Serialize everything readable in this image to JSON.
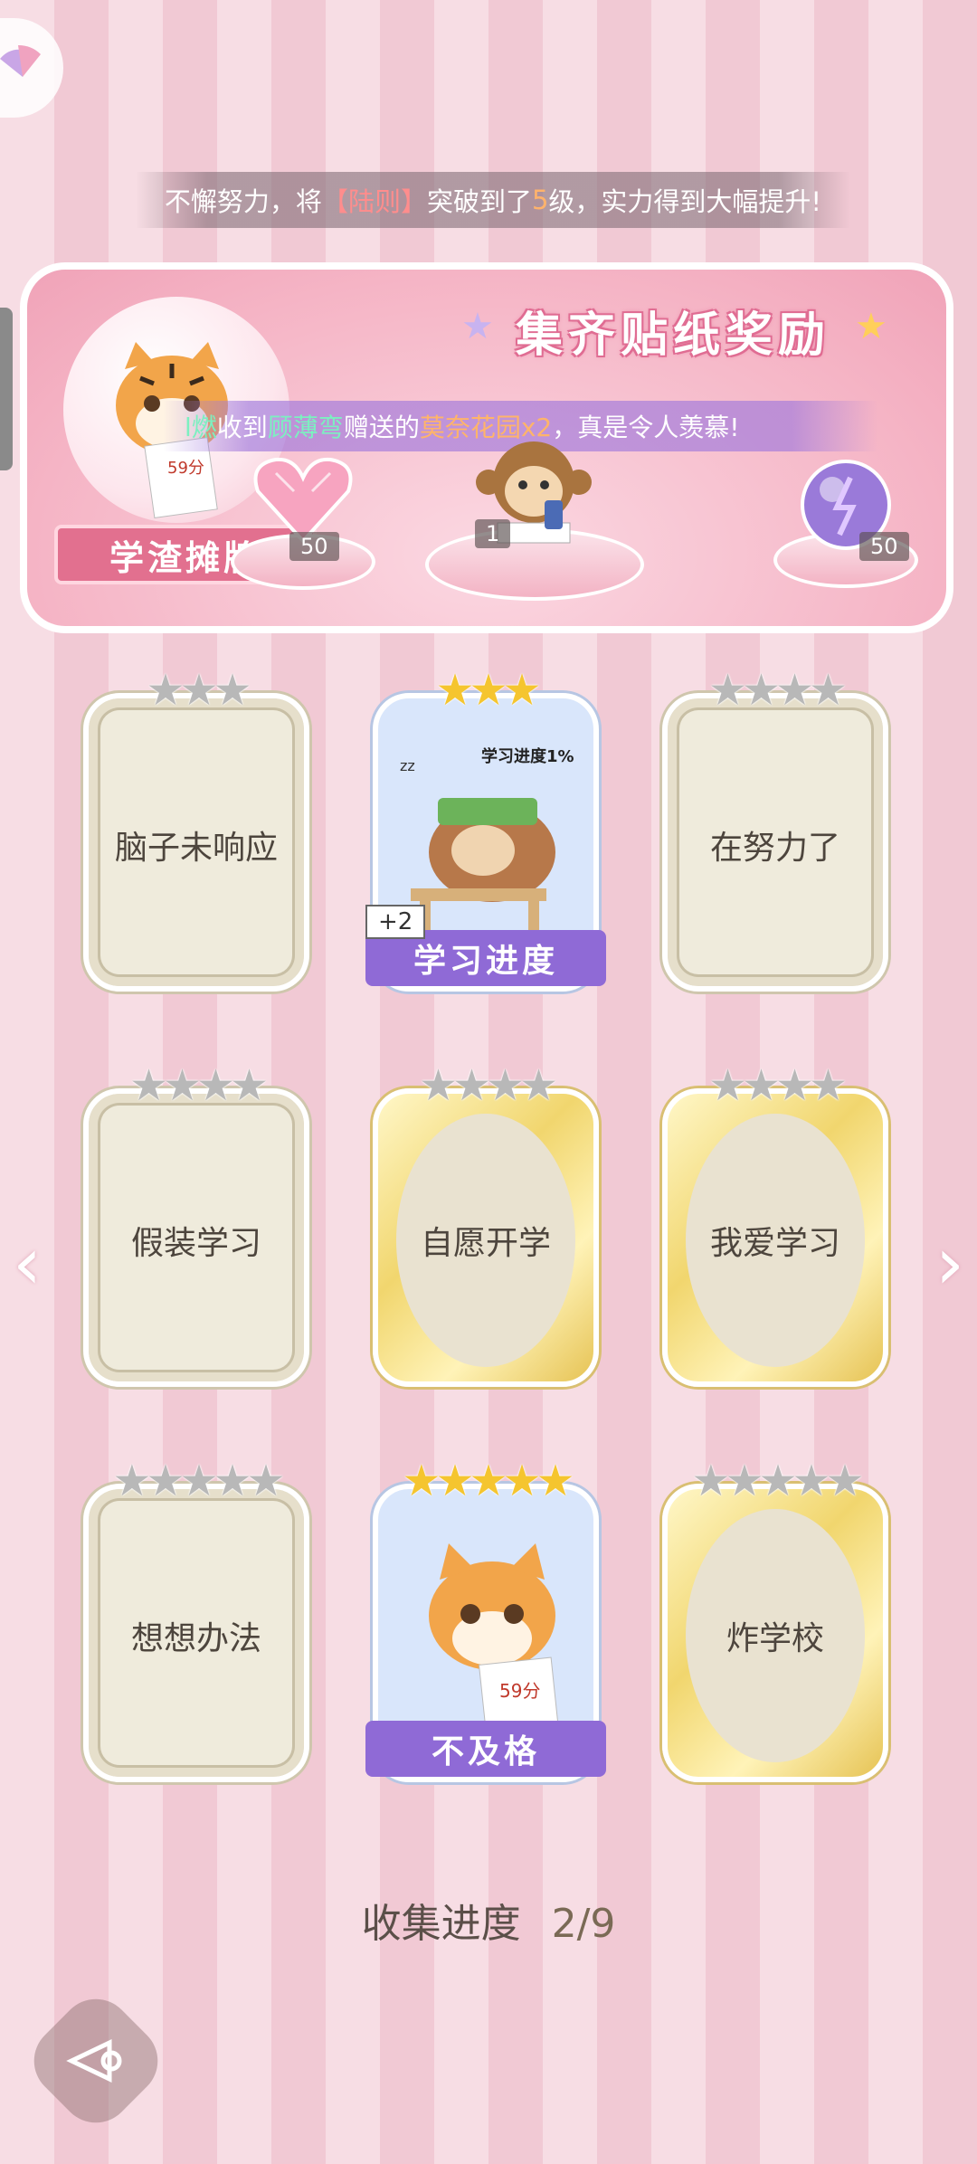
{
  "ticker": {
    "prefix": "不懈努力，将",
    "name": "【陆则】",
    "middle": "突破到了",
    "level": "5",
    "suffix": "级，实力得到大幅提升!"
  },
  "reward_panel": {
    "title": "集齐贴纸奖励",
    "ribbon_label": "学渣摊牌",
    "rewards": [
      {
        "icon": "pink-heart-gem-icon",
        "count": "50"
      },
      {
        "icon": "monkey-studying-icon",
        "count": "1"
      },
      {
        "icon": "purple-orb-icon",
        "count": "50"
      }
    ]
  },
  "broadcast": {
    "user": "l燃",
    "text1": "收到",
    "sender": "顾薄弯",
    "text2": "赠送的",
    "gift": "莫奈花园x2",
    "text3": "，真是令人羡慕!"
  },
  "cards": [
    {
      "label": "脑子未响应",
      "stars": 3,
      "gold_stars": 0,
      "style": "plain"
    },
    {
      "label": "学习进度",
      "stars": 3,
      "gold_stars": 3,
      "style": "photo",
      "caption": "学习进度1%",
      "badge": "+2"
    },
    {
      "label": "在努力了",
      "stars": 4,
      "gold_stars": 0,
      "style": "plain"
    },
    {
      "label": "假装学习",
      "stars": 4,
      "gold_stars": 0,
      "style": "plain"
    },
    {
      "label": "自愿开学",
      "stars": 4,
      "gold_stars": 0,
      "style": "gold"
    },
    {
      "label": "我爱学习",
      "stars": 4,
      "gold_stars": 0,
      "style": "gold"
    },
    {
      "label": "想想办法",
      "stars": 5,
      "gold_stars": 0,
      "style": "plain"
    },
    {
      "label": "不及格",
      "stars": 5,
      "gold_stars": 5,
      "style": "photo",
      "caption": "59分"
    },
    {
      "label": "炸学校",
      "stars": 5,
      "gold_stars": 0,
      "style": "gold"
    }
  ],
  "progress": {
    "label": "收集进度",
    "value": "2/9"
  },
  "nav": {
    "prev": "‹",
    "next": "›"
  },
  "colors": {
    "accent_pink": "#e2708f",
    "purple_banner": "#8f6ad6",
    "gold_star": "#f5c52f"
  }
}
